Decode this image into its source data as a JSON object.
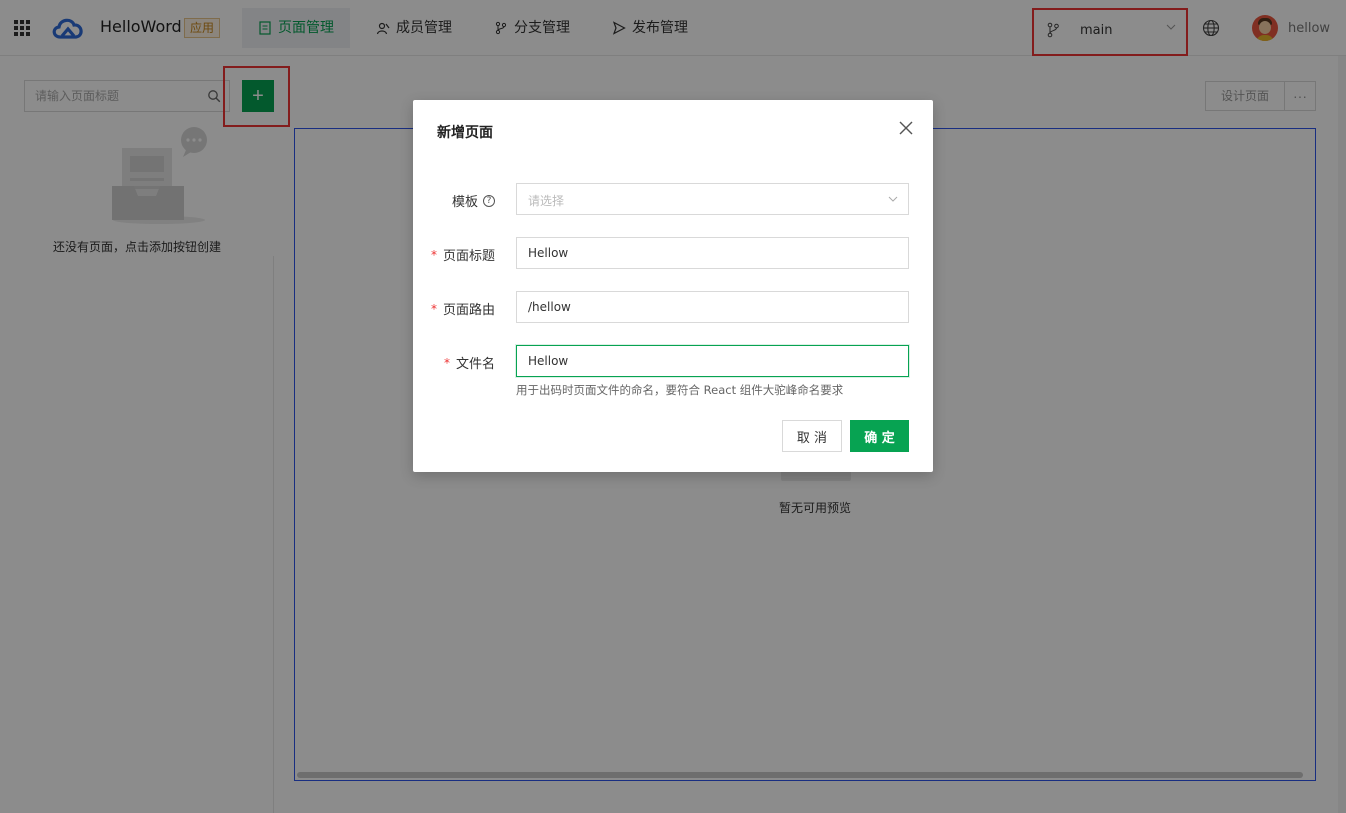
{
  "header": {
    "app_name": "HelloWord",
    "app_badge": "应用",
    "nav": [
      {
        "label": "页面管理",
        "icon": "page-icon",
        "active": true
      },
      {
        "label": "成员管理",
        "icon": "members-icon"
      },
      {
        "label": "分支管理",
        "icon": "branch-icon"
      },
      {
        "label": "发布管理",
        "icon": "send-icon"
      }
    ],
    "branch": {
      "label": "main",
      "icon": "branch-icon"
    },
    "user": {
      "name": "hellow"
    }
  },
  "sidebar": {
    "search_placeholder": "请输入页面标题",
    "add_label": "+",
    "empty_text": "还没有页面，点击添加按钮创建"
  },
  "main": {
    "design_label": "设计页面",
    "more_label": "···",
    "preview_empty_text": "暂无可用预览"
  },
  "modal": {
    "title": "新增页面",
    "fields": {
      "template": {
        "label": "模板",
        "placeholder": "请选择"
      },
      "page_title": {
        "label": "页面标题",
        "value": "Hellow"
      },
      "page_route": {
        "label": "页面路由",
        "value": "/hellow"
      },
      "file_name": {
        "label": "文件名",
        "value": "Hellow"
      }
    },
    "hint": "用于出码时页面文件的命名，要符合 React 组件大驼峰命名要求",
    "cancel_label": "取 消",
    "ok_label": "确 定",
    "required_mark": "*",
    "help_mark": "?"
  },
  "colors": {
    "brand": "#07a352",
    "highlight": "#ee3333",
    "frame": "#2f54eb"
  }
}
